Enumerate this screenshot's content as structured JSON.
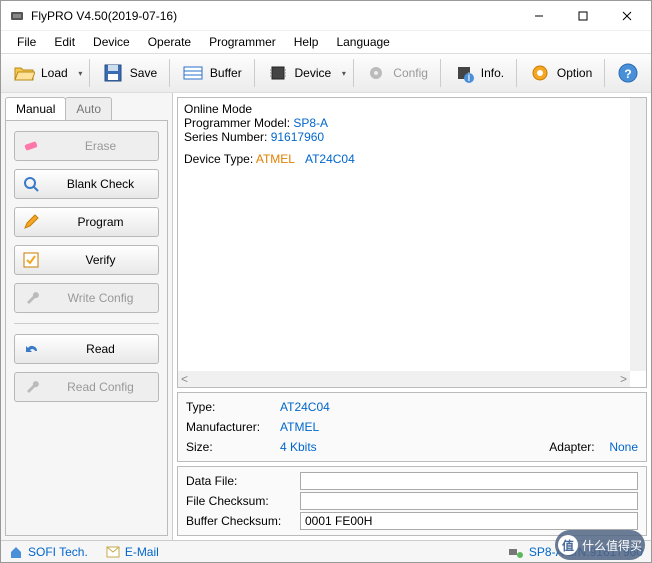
{
  "window": {
    "title": "FlyPRO V4.50(2019-07-16)"
  },
  "menu": {
    "file": "File",
    "edit": "Edit",
    "device": "Device",
    "operate": "Operate",
    "programmer": "Programmer",
    "help": "Help",
    "language": "Language"
  },
  "toolbar": {
    "load": "Load",
    "save": "Save",
    "buffer": "Buffer",
    "device": "Device",
    "config": "Config",
    "info": "Info.",
    "option": "Option"
  },
  "tabs": {
    "manual": "Manual",
    "auto": "Auto"
  },
  "ops": {
    "erase": "Erase",
    "blank": "Blank Check",
    "program": "Program",
    "verify": "Verify",
    "writecfg": "Write Config",
    "read": "Read",
    "readcfg": "Read Config"
  },
  "output": {
    "l1": "Online Mode",
    "l2a": "Programmer Model: ",
    "l2b": "SP8-A",
    "l3a": "Series Number: ",
    "l3b": "91617960",
    "l4a": "Device Type: ",
    "l4b": "ATMEL",
    "l4c": "AT24C04"
  },
  "info": {
    "type_k": "Type:",
    "type_v": "AT24C04",
    "manu_k": "Manufacturer:",
    "manu_v": "ATMEL",
    "size_k": "Size:",
    "size_v": "4 Kbits",
    "adapter_k": "Adapter:",
    "adapter_v": "None",
    "datafile_k": "Data File:",
    "datafile_v": "",
    "filecs_k": "File Checksum:",
    "filecs_v": "",
    "bufcs_k": "Buffer Checksum:",
    "bufcs_v": "0001 FE00H"
  },
  "status": {
    "sofi": "SOFI Tech.",
    "email": "E-Mail",
    "conn": "SP8-A S/N:91617960"
  },
  "watermark": "什么值得买"
}
